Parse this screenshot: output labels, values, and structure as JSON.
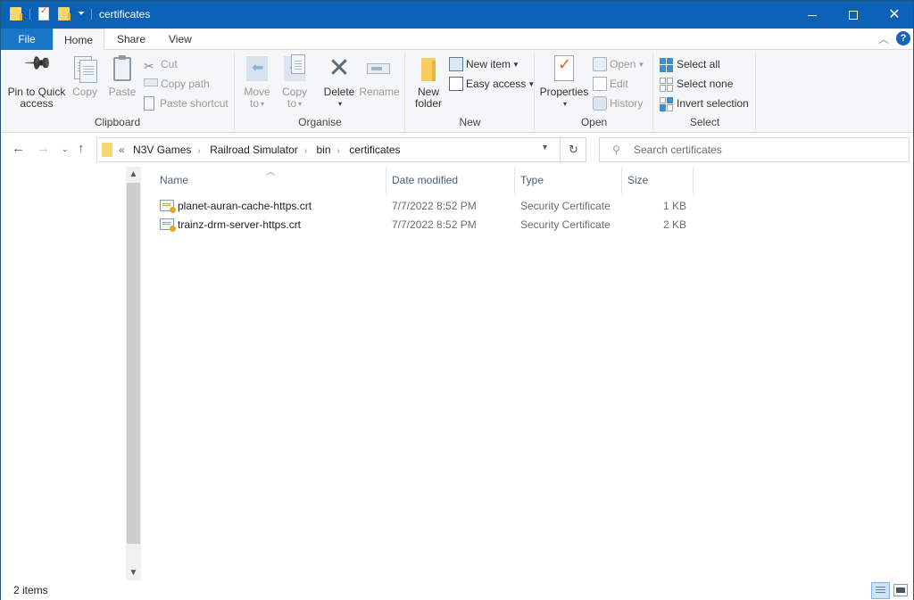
{
  "window": {
    "title": "certificates",
    "controls": {
      "minimize": "minimize",
      "maximize": "maximize",
      "close": "✕"
    }
  },
  "quick_access": {
    "icons": [
      "folder-icon",
      "properties-icon",
      "new-folder-icon",
      "customize-dropdown-icon"
    ]
  },
  "ribbon_tabs": [
    {
      "label": "File"
    },
    {
      "label": "Home",
      "active": true
    },
    {
      "label": "Share"
    },
    {
      "label": "View"
    }
  ],
  "ribbon": {
    "clipboard": {
      "label": "Clipboard",
      "pin_line1": "Pin to Quick",
      "pin_line2": "access",
      "copy": "Copy",
      "paste": "Paste",
      "cut": "Cut",
      "copy_path": "Copy path",
      "paste_shortcut": "Paste shortcut"
    },
    "organise": {
      "label": "Organise",
      "move_line1": "Move",
      "move_line2": "to",
      "copy_line1": "Copy",
      "copy_line2": "to",
      "delete": "Delete",
      "rename": "Rename"
    },
    "new": {
      "label": "New",
      "new_folder_line1": "New",
      "new_folder_line2": "folder",
      "new_item": "New item",
      "easy_access": "Easy access"
    },
    "open": {
      "label": "Open",
      "properties": "Properties",
      "open": "Open",
      "edit": "Edit",
      "history": "History"
    },
    "select": {
      "label": "Select",
      "select_all": "Select all",
      "select_none": "Select none",
      "invert_selection": "Invert selection"
    }
  },
  "address": {
    "overflow": "«",
    "breadcrumbs": [
      "N3V Games",
      "Railroad Simulator",
      "bin",
      "certificates"
    ],
    "separator": "›"
  },
  "search": {
    "placeholder": "Search certificates",
    "value": ""
  },
  "columns": {
    "name": "Name",
    "date": "Date modified",
    "type": "Type",
    "size": "Size"
  },
  "files": [
    {
      "name": "planet-auran-cache-https.crt",
      "date": "7/7/2022 8:52 PM",
      "type": "Security Certificate",
      "size": "1 KB"
    },
    {
      "name": "trainz-drm-server-https.crt",
      "date": "7/7/2022 8:52 PM",
      "type": "Security Certificate",
      "size": "2 KB"
    }
  ],
  "status": {
    "item_count": "2 items"
  },
  "colors": {
    "titlebar": "#0b61b5",
    "file_tab": "#1975c5",
    "ribbon_bg": "#f5f6f7",
    "header_text": "#4c607a",
    "selected_view": "#cce4f7"
  }
}
